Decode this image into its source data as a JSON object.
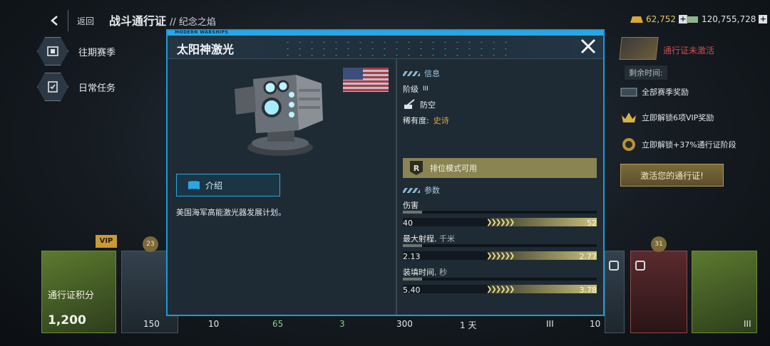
{
  "header": {
    "back_label": "返回",
    "title": "战斗通行证",
    "subtitle": "// 纪念之焰"
  },
  "currency": {
    "gold": "62,752",
    "cash": "120,755,728"
  },
  "side_menu": [
    {
      "label": "往期赛季"
    },
    {
      "label": "日常任务"
    }
  ],
  "pass_panel": {
    "status": "通行证未激活",
    "remaining_label": "剩余时间:",
    "rewards": [
      {
        "label": "全部赛季奖励"
      },
      {
        "label": "立即解锁6项VIP奖励"
      },
      {
        "label": "立即解锁+37%通行证阶段"
      }
    ],
    "activate_button": "激活您的通行证!"
  },
  "track": {
    "vip_tag": "VIP",
    "level_left": "23",
    "level_right": "31",
    "points_label": "通行证积分",
    "points_value": "1,200",
    "strip_values": [
      "150",
      "10",
      "65",
      "3",
      "300",
      "1 天",
      "III",
      "10",
      "III"
    ]
  },
  "dialog": {
    "brand": "MODERN WARSHIPS",
    "title": "太阳神激光",
    "intro_tab": "介绍",
    "description": "美国海军高能激光器发展计划。",
    "info": {
      "section_title": "信息",
      "tier_label": "阶级",
      "tier_value": "III",
      "type": "防空",
      "rarity_label": "稀有度:",
      "rarity_value": "史诗",
      "mode_badge": "R",
      "mode_text": "排位模式可用"
    },
    "params": {
      "section_title": "参数",
      "items": [
        {
          "label": "伤害",
          "unit": "",
          "base": "40",
          "upgraded": "52",
          "base_fraction": 0.1,
          "upgraded_fraction": 0.55
        },
        {
          "label": "最大射程",
          "unit": ", 千米",
          "base": "2.13",
          "upgraded": "2.77",
          "base_fraction": 0.1,
          "upgraded_fraction": 0.55
        },
        {
          "label": "装填时间",
          "unit": ", 秒",
          "base": "5.40",
          "upgraded": "3.78",
          "base_fraction": 0.1,
          "upgraded_fraction": 0.55
        }
      ]
    }
  },
  "colors": {
    "accent": "#1d9ad6",
    "rarity_epic": "#e6a233",
    "mode_bar": "#8a8452"
  }
}
